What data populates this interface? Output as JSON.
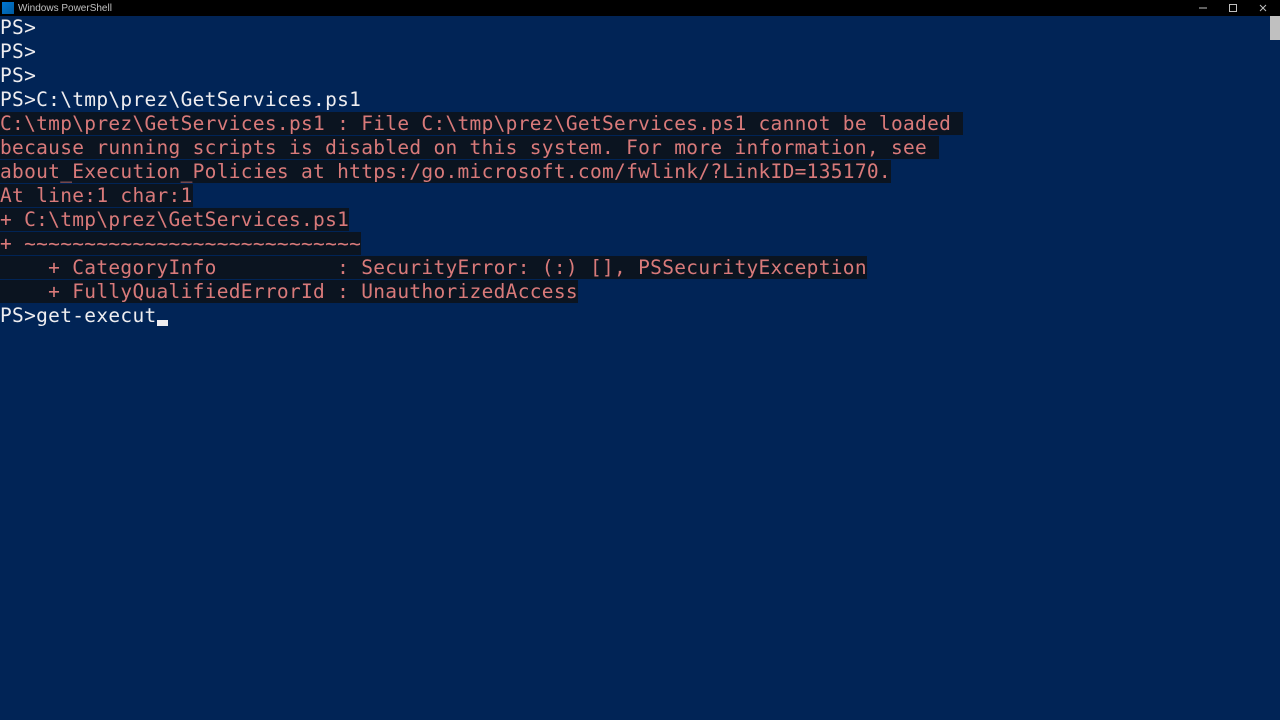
{
  "window": {
    "title": "Windows PowerShell"
  },
  "terminal": {
    "prompt": "PS>",
    "lines": {
      "blank1": "PS>",
      "blank2": "PS>",
      "blank3": "PS>",
      "cmd1_prompt": "PS>",
      "cmd1": "C:\\tmp\\prez\\GetServices.ps1",
      "err1": "C:\\tmp\\prez\\GetServices.ps1 : File C:\\tmp\\prez\\GetServices.ps1 cannot be loaded ",
      "err2": "because running scripts is disabled on this system. For more information, see ",
      "err3": "about_Execution_Policies at https:/go.microsoft.com/fwlink/?LinkID=135170.",
      "err4": "At line:1 char:1",
      "err5": "+ C:\\tmp\\prez\\GetServices.ps1",
      "err6": "+ ~~~~~~~~~~~~~~~~~~~~~~~~~~~~",
      "err7": "    + CategoryInfo          : SecurityError: (:) [], PSSecurityException",
      "err8": "    + FullyQualifiedErrorId : UnauthorizedAccess",
      "current_prompt": "PS>",
      "current_input": "get-execut"
    }
  }
}
